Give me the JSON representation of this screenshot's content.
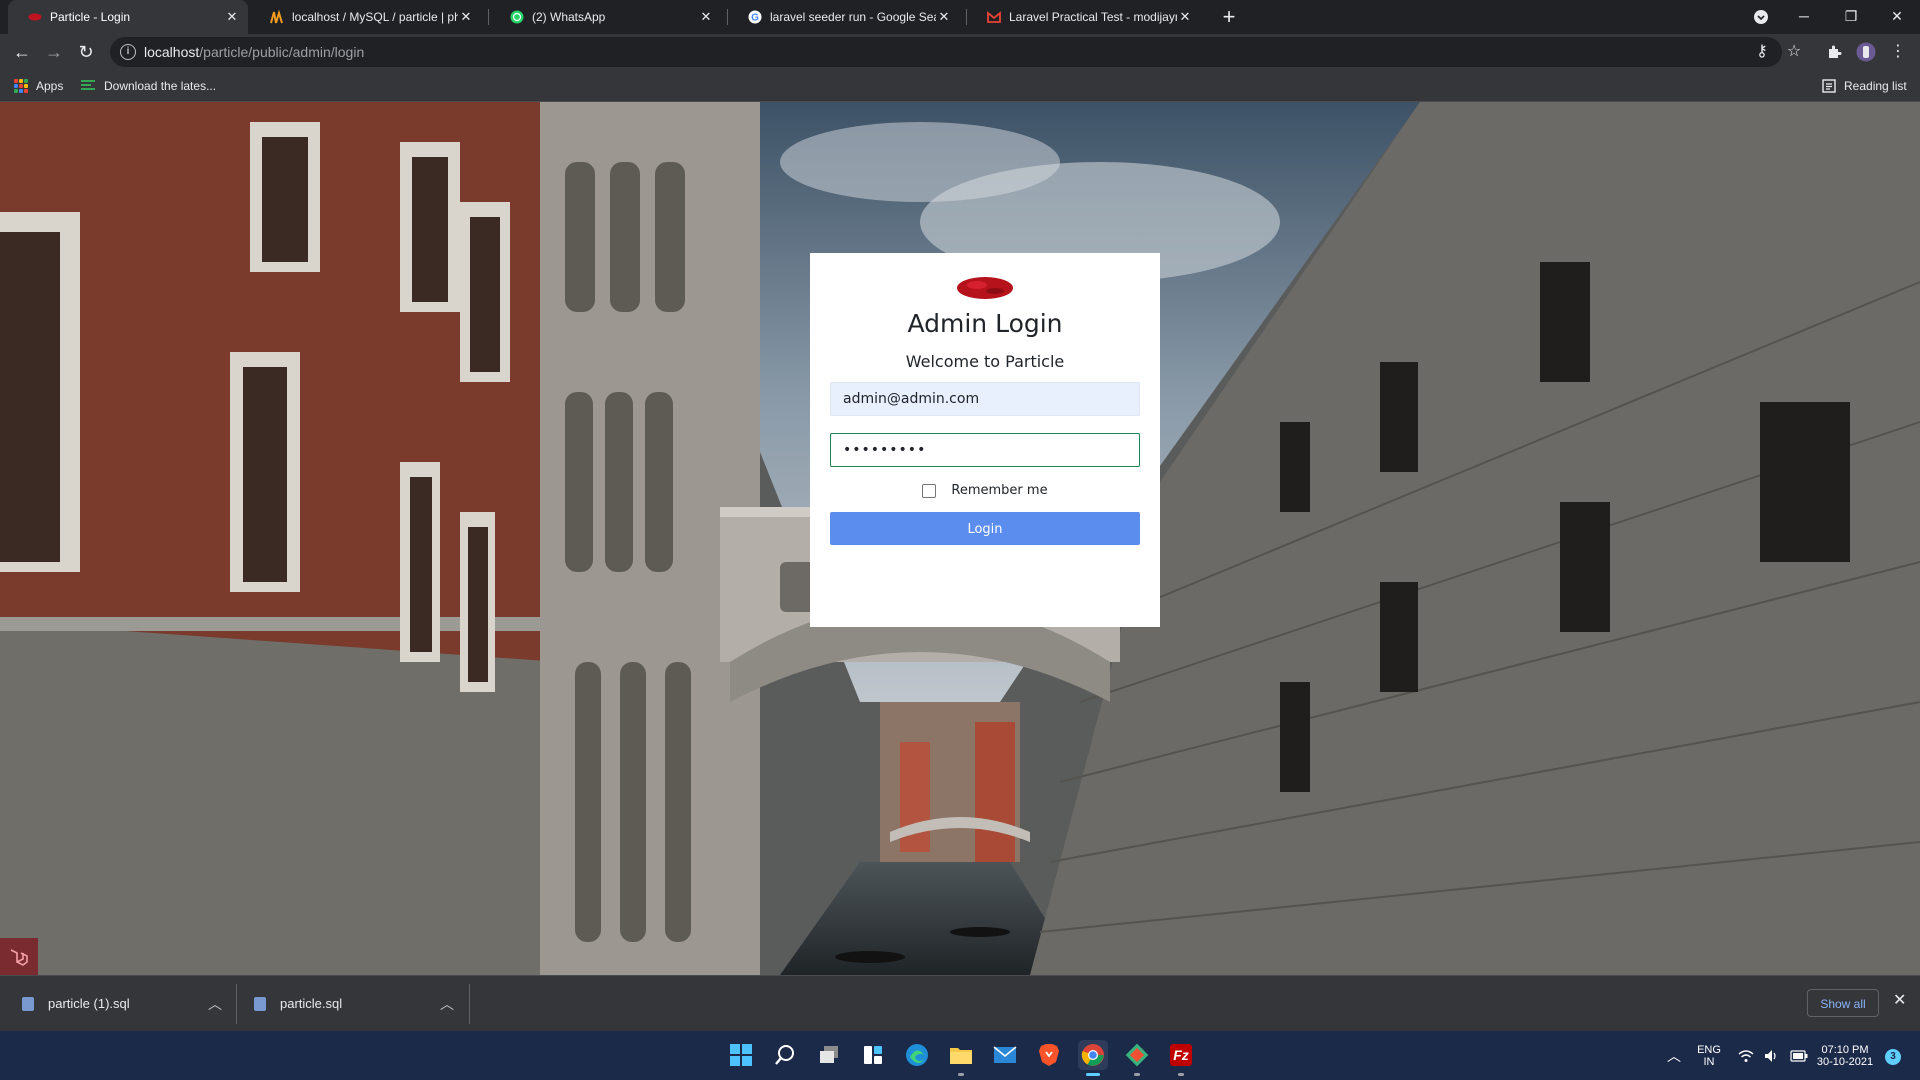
{
  "browser": {
    "tabs": [
      {
        "title": "Particle - Login",
        "icon": "particle-favicon",
        "active": true
      },
      {
        "title": "localhost / MySQL / particle | phpMyAdmin",
        "icon": "phpmyadmin-favicon",
        "active": false
      },
      {
        "title": "(2) WhatsApp",
        "icon": "whatsapp-favicon",
        "active": false
      },
      {
        "title": "laravel seeder run - Google Search",
        "icon": "google-favicon",
        "active": false
      },
      {
        "title": "Laravel Practical Test - modijaymin",
        "icon": "gmail-favicon",
        "active": false
      }
    ],
    "new_tab_icon": "plus-icon",
    "address": {
      "host": "localhost",
      "path": "/particle/public/admin/login"
    },
    "bookmarks": [
      {
        "label": "Apps",
        "icon": "apps-grid-icon"
      },
      {
        "label": "Download the lates...",
        "icon": "bookmark-favicon"
      }
    ],
    "reading_list": "Reading list"
  },
  "login": {
    "title": "Admin Login",
    "subtitle": "Welcome to Particle",
    "email_value": "admin@admin.com",
    "password_value": "•••••••••",
    "remember_label": "Remember me",
    "remember_checked": false,
    "submit_label": "Login"
  },
  "downloads": {
    "items": [
      {
        "name": "particle (1).sql"
      },
      {
        "name": "particle.sql"
      }
    ],
    "show_all": "Show all"
  },
  "taskbar": {
    "apps": [
      "start-icon",
      "search-icon",
      "task-view-icon",
      "widgets-icon",
      "edge-icon",
      "file-explorer-icon",
      "mail-icon",
      "brave-icon",
      "chrome-icon",
      "git-icon",
      "filezilla-icon"
    ],
    "lang_top": "ENG",
    "lang_bottom": "IN",
    "time": "07:10 PM",
    "date": "30-10-2021",
    "notifications": "3"
  },
  "colors": {
    "accent": "#5b8def",
    "password_border": "#198754",
    "chrome_dark": "#202124",
    "chrome_toolbar": "#35363a",
    "taskbar": "#1c2a4a"
  }
}
